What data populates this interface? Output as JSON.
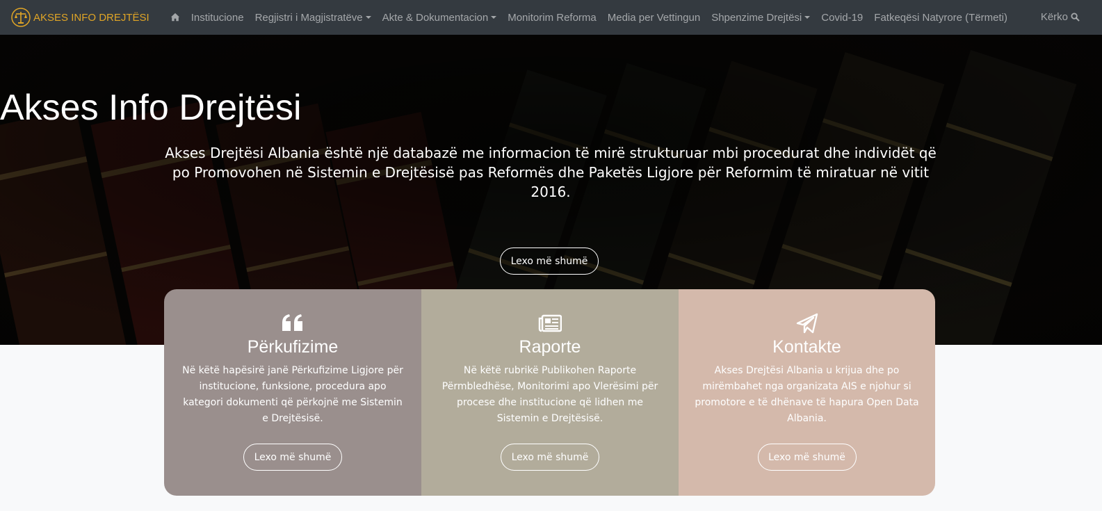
{
  "nav": {
    "brand": "AKSES INFO DREJTËSI",
    "items": [
      {
        "label": "Institucione",
        "dropdown": false
      },
      {
        "label": "Regjistri i Magjistratëve",
        "dropdown": true
      },
      {
        "label": "Akte & Dokumentacion",
        "dropdown": true
      },
      {
        "label": "Monitorim Reforma",
        "dropdown": false
      },
      {
        "label": "Media per Vettingun",
        "dropdown": false
      },
      {
        "label": "Shpenzime Drejtësi",
        "dropdown": true
      },
      {
        "label": "Covid-19",
        "dropdown": false
      },
      {
        "label": "Fatkeqësi Natyrore (Tërmeti)",
        "dropdown": false
      }
    ],
    "search_label": "Kërko"
  },
  "hero": {
    "title": "Akses Info Drejtësi",
    "description": "Akses Drejtësi Albania është një databazë me informacion të mirë strukturuar mbi procedurat dhe individët që po Promovohen në Sistemin e Drejtësisë pas Reformës dhe Paketës Ligjore për Reformim të miratuar në vitit 2016.",
    "button": "Lexo më shumë"
  },
  "cards": [
    {
      "icon": "quote-icon",
      "title": "Përkufizime",
      "text": "Në këtë hapësirë janë Përkufizime Ligjore për institucione, funksione, procedura apo kategori dokumenti që përkojnë me Sistemin e Drejtësisë.",
      "button": "Lexo më shumë",
      "color": "#9a8f8d"
    },
    {
      "icon": "newspaper-icon",
      "title": "Raporte",
      "text": "Në këtë rubrikë Publikohen Raporte Përmbledhëse, Monitorimi apo Vlerësimi për procese dhe institucione që lidhen me Sistemin e Drejtësisë.",
      "button": "Lexo më shumë",
      "color": "#b2ac9b"
    },
    {
      "icon": "paper-plane-icon",
      "title": "Kontakte",
      "text": "Akses Drejtësi Albania u krijua dhe po mirëmbahet nga organizata AIS e njohur si promotore e të dhënave të hapura Open Data Albania.",
      "button": "Lexo më shumë",
      "color": "#d4b9ab"
    }
  ]
}
